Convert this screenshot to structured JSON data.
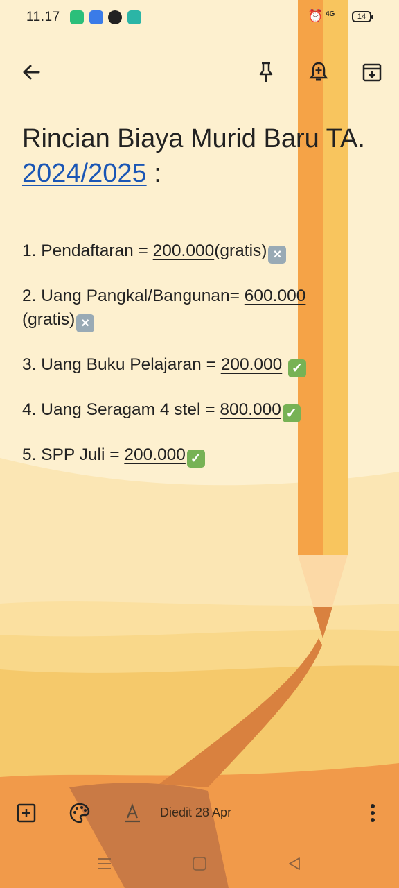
{
  "status_bar": {
    "time": "11.17",
    "network": "4G",
    "battery": "14",
    "app_icons": [
      "battery-saver-icon",
      "files-icon",
      "chrome-icon",
      "chat-icon"
    ]
  },
  "toolbar": {
    "icons": [
      "back-arrow-icon",
      "pin-icon",
      "reminder-bell-icon",
      "archive-icon"
    ]
  },
  "note": {
    "title_text": "Rincian Biaya Murid Baru TA.",
    "title_year": "2024/2025",
    "title_suffix": " :",
    "items": [
      {
        "prefix": "1. Pendaftaran = ",
        "amount": "200.000",
        "suffix": "(gratis)",
        "mark": "cross"
      },
      {
        "prefix": "2. Uang Pangkal/Bangunan= ",
        "amount": "600.000",
        "suffix": "(gratis)",
        "mark": "cross"
      },
      {
        "prefix": "3. Uang Buku Pelajaran = ",
        "amount": "200.000",
        "suffix": " ",
        "mark": "check"
      },
      {
        "prefix": "4. Uang Seragam 4 stel = ",
        "amount": "800.000",
        "suffix": "",
        "mark": "check"
      },
      {
        "prefix": "5. SPP Juli = ",
        "amount": "200.000",
        "suffix": "",
        "mark": "check"
      }
    ]
  },
  "bottom_bar": {
    "edited": "Diedit 28 Apr"
  },
  "colors": {
    "background": "#fdf0cf",
    "link": "#1a56b5",
    "sand_dark": "#f19a4a",
    "pencil": "#f5a347"
  }
}
